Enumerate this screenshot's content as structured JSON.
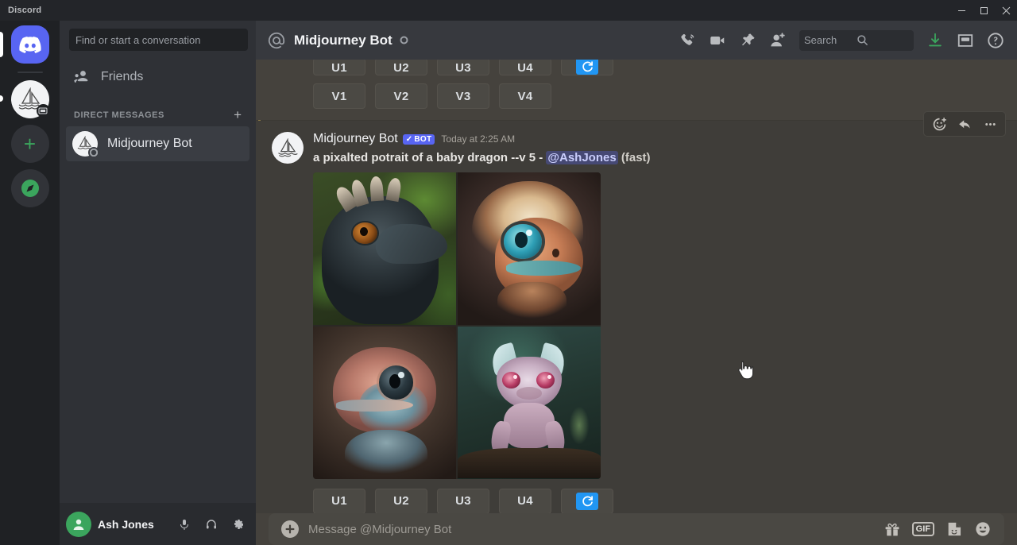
{
  "window": {
    "brand": "Discord",
    "controls": {
      "minimize": "–",
      "maximize": "□",
      "close": "✕"
    }
  },
  "server_rail": {
    "items": [
      {
        "name": "home",
        "label": "Discord Home",
        "color": "#5865f2"
      },
      {
        "name": "midjourney",
        "label": "Midjourney",
        "color": "#f2f3f5"
      },
      {
        "name": "add-server",
        "label": "+",
        "color": "#3ba55d"
      },
      {
        "name": "explore",
        "label": "Explore Public Servers",
        "color": "#3ba55d"
      }
    ]
  },
  "sidebar": {
    "search_placeholder": "Find or start a conversation",
    "nav": [
      {
        "label": "Friends",
        "icon": "friends-icon"
      }
    ],
    "dm_section": {
      "title": "DIRECT MESSAGES",
      "add_label": "+"
    },
    "dms": [
      {
        "label": "Midjourney Bot",
        "status": "offline"
      }
    ]
  },
  "user_panel": {
    "name": "Ash Jones",
    "icons": [
      "microphone-icon",
      "headphones-icon",
      "settings-icon"
    ]
  },
  "chat_header": {
    "at_symbol": "@",
    "title": "Midjourney Bot",
    "status": "offline",
    "icons": [
      "voice-call-icon",
      "video-call-icon",
      "pin-icon",
      "add-friend-icon",
      "inbox-icon",
      "help-icon"
    ],
    "search": {
      "placeholder": "Search"
    }
  },
  "messages": {
    "previous": {
      "button_rows": [
        [
          "U1",
          "U2",
          "U3",
          "U4",
          "refresh"
        ],
        [
          "V1",
          "V2",
          "V3",
          "V4"
        ]
      ]
    },
    "current": {
      "author": "Midjourney Bot",
      "bot_tag": "BOT",
      "bot_tag_check": "✓",
      "timestamp": "Today at 2:25 AM",
      "prompt_text": "a pixalted potrait of a baby dragon --v 5 - ",
      "mention": "@AshJones",
      "suffix": " (fast)",
      "images": [
        {
          "id": 1,
          "alt": "dark teal baby dragon in green jungle"
        },
        {
          "id": 2,
          "alt": "cream and orange fluffy baby dragon with large teal eye"
        },
        {
          "id": 3,
          "alt": "pink and blue scaled baby dragon close-up"
        },
        {
          "id": 4,
          "alt": "pink lavender baby dragon on branch in forest"
        }
      ],
      "button_row": [
        "U1",
        "U2",
        "U3",
        "U4"
      ],
      "refresh_label": "refresh",
      "hover_tools": [
        "add-reaction-icon",
        "reply-icon",
        "more-options-icon"
      ]
    }
  },
  "composer": {
    "placeholder": "Message @Midjourney Bot",
    "add_label": "+",
    "icons": [
      "gift-icon",
      "gif-icon",
      "sticker-icon",
      "emoji-icon"
    ],
    "gif_label": "GIF"
  },
  "colors": {
    "brand": "#5865f2",
    "chat_bg": "#45423d",
    "sidebar_bg": "#2f3136",
    "rail_bg": "#1f2124",
    "accent_rail": "#8a7848",
    "refresh_blue": "#2196f3",
    "online_green": "#3ba55d"
  }
}
